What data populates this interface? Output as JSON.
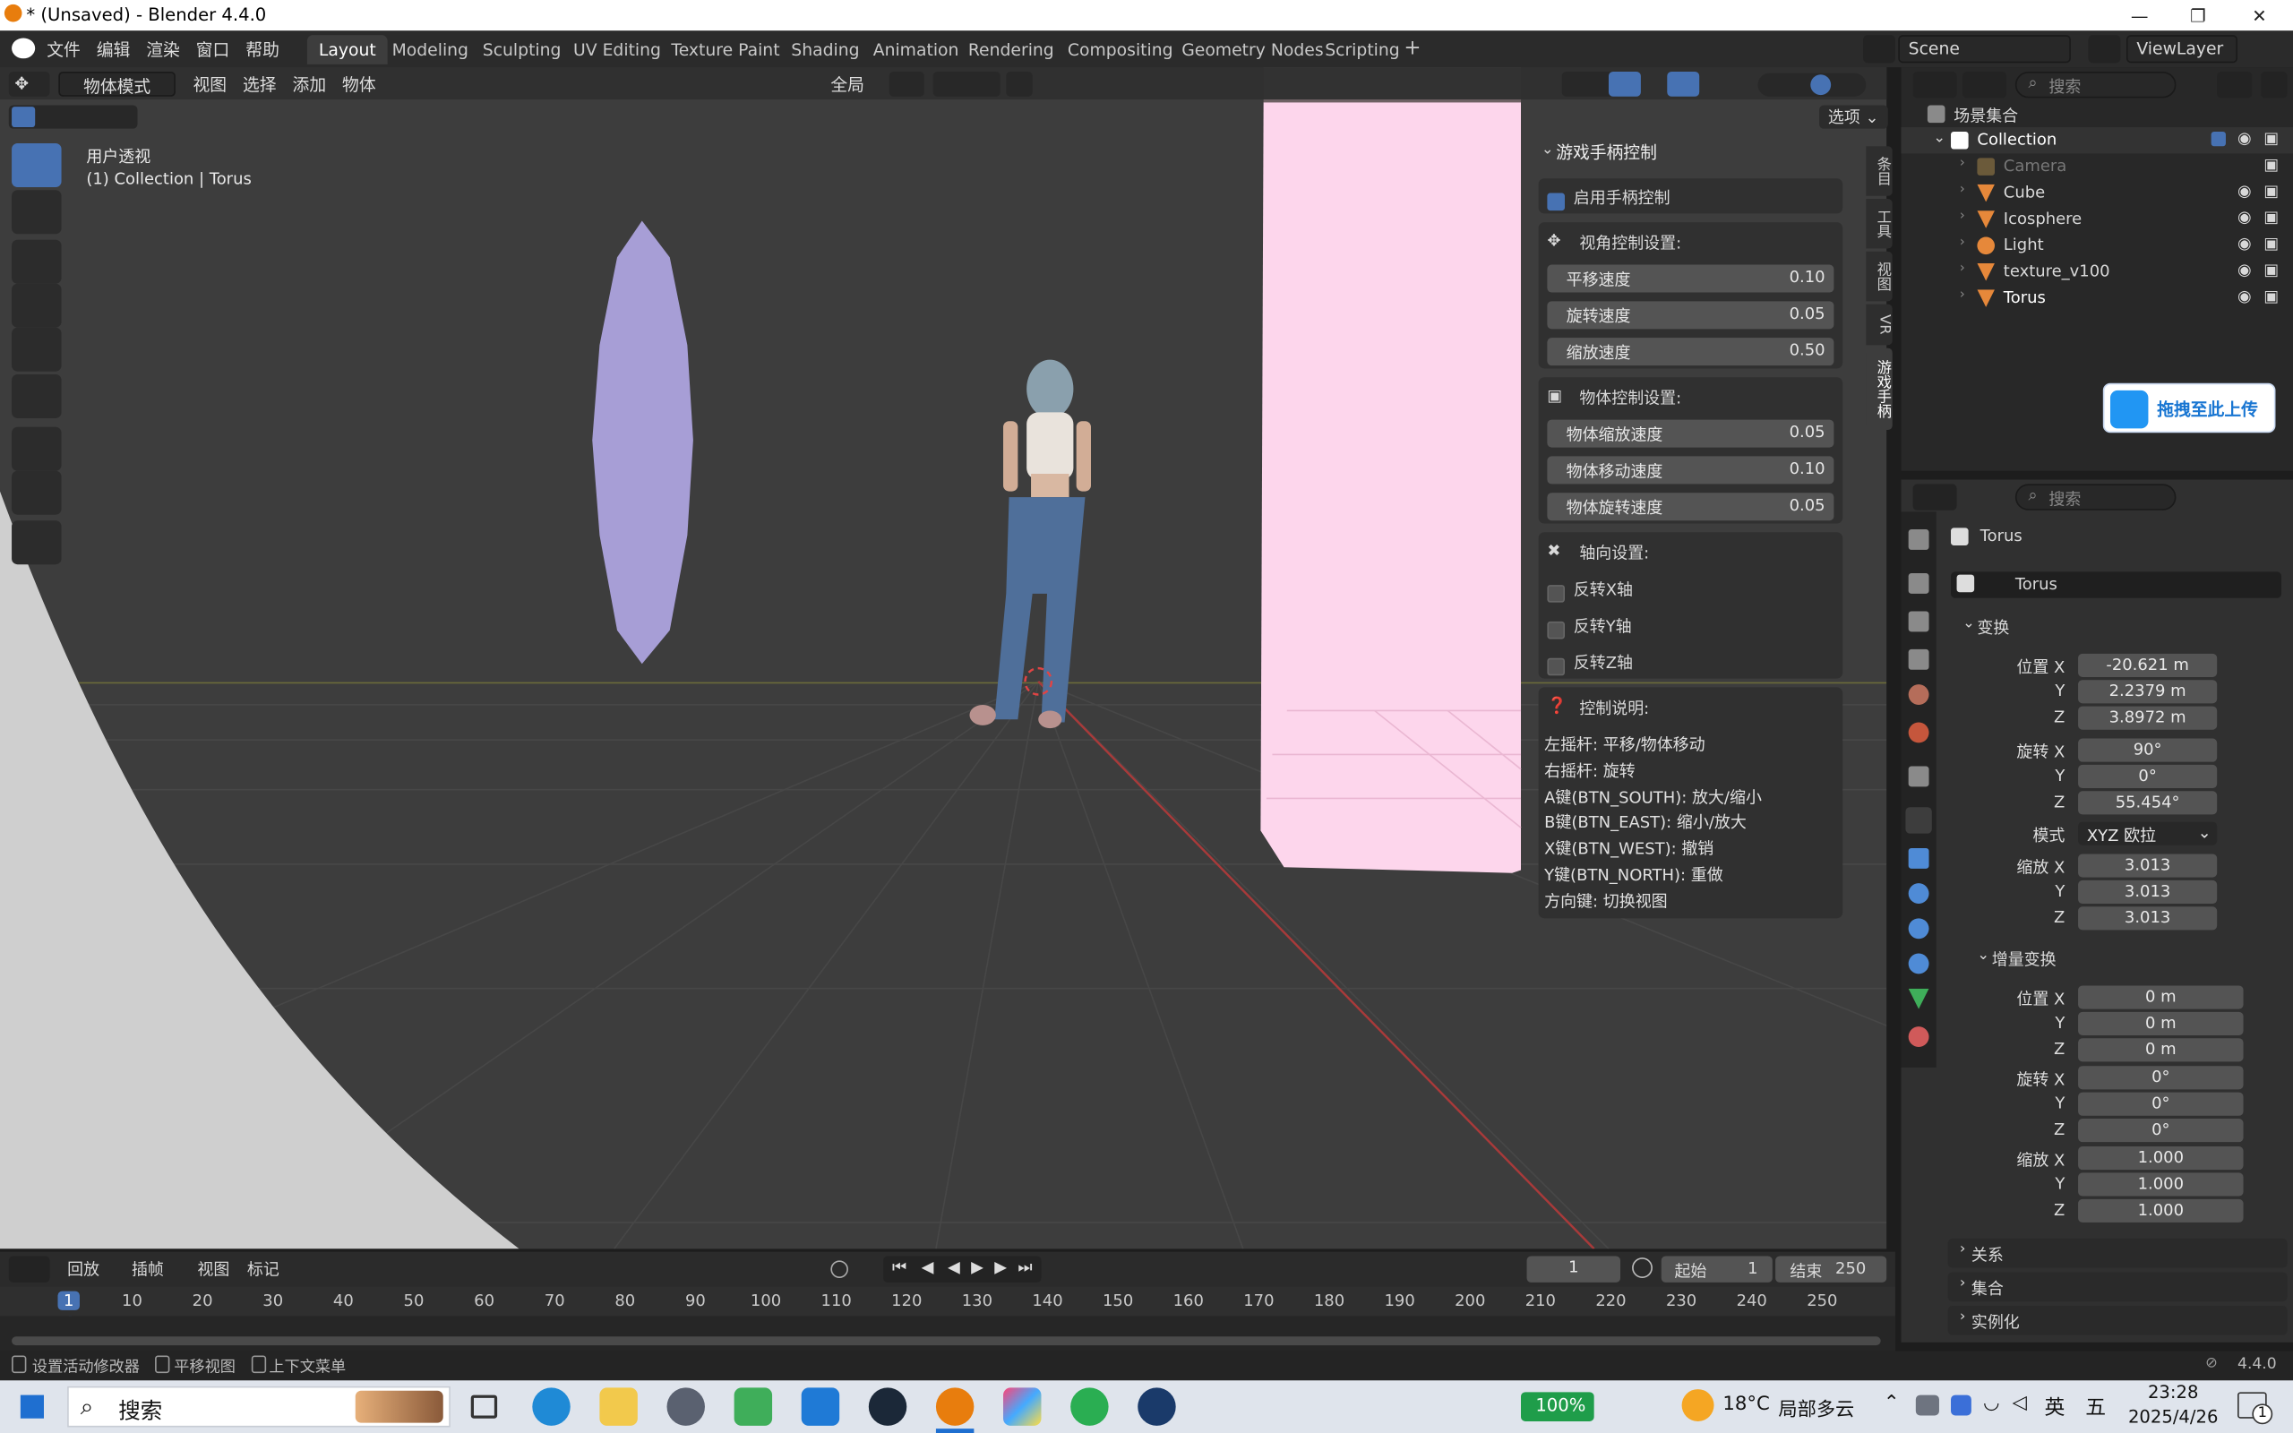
{
  "window": {
    "title": "* (Unsaved) - Blender 4.4.0"
  },
  "menu": [
    "文件",
    "编辑",
    "渲染",
    "窗口",
    "帮助"
  ],
  "workspaces": [
    {
      "label": "Layout",
      "active": true
    },
    {
      "label": "Modeling"
    },
    {
      "label": "Sculpting"
    },
    {
      "label": "UV Editing"
    },
    {
      "label": "Texture Paint"
    },
    {
      "label": "Shading"
    },
    {
      "label": "Animation"
    },
    {
      "label": "Rendering"
    },
    {
      "label": "Compositing"
    },
    {
      "label": "Geometry Nodes"
    },
    {
      "label": "Scripting"
    }
  ],
  "scene": {
    "name": "Scene",
    "view_layer": "ViewLayer"
  },
  "viewport_header": {
    "mode": "物体模式",
    "view": "视图",
    "select": "选择",
    "add": "添加",
    "object": "物体",
    "transform_orientation": "全局",
    "options": "选项"
  },
  "viewport_overlay": {
    "view_name": "用户透视",
    "context": "(1) Collection | Torus"
  },
  "npanel": {
    "title": "游戏手柄控制",
    "enable_label": "启用手柄控制",
    "enable_checked": true,
    "view_section": "视角控制设置:",
    "view_rows": [
      {
        "label": "平移速度",
        "value": "0.10"
      },
      {
        "label": "旋转速度",
        "value": "0.05"
      },
      {
        "label": "缩放速度",
        "value": "0.50"
      }
    ],
    "object_section": "物体控制设置:",
    "object_rows": [
      {
        "label": "物体缩放速度",
        "value": "0.05"
      },
      {
        "label": "物体移动速度",
        "value": "0.10"
      },
      {
        "label": "物体旋转速度",
        "value": "0.05"
      }
    ],
    "axis_section": "轴向设置:",
    "axis_rows": [
      "反转X轴",
      "反转Y轴",
      "反转Z轴"
    ],
    "help_section": "控制说明:",
    "help_lines": [
      "左摇杆: 平移/物体移动",
      "右摇杆: 旋转",
      "A键(BTN_SOUTH): 放大/缩小",
      "B键(BTN_EAST): 缩小/放大",
      "X键(BTN_WEST): 撤销",
      "Y键(BTN_NORTH): 重做",
      "方向键: 切换视图"
    ]
  },
  "side_tabs": [
    "条目",
    "工具",
    "视图",
    "VR",
    "游戏手柄"
  ],
  "outliner": {
    "search_placeholder": "搜索",
    "root": "场景集合",
    "collection": "Collection",
    "items": [
      {
        "name": "Camera",
        "icon": "camera-icon",
        "dim": true
      },
      {
        "name": "Cube",
        "icon": "mesh-icon"
      },
      {
        "name": "Icosphere",
        "icon": "mesh-icon"
      },
      {
        "name": "Light",
        "icon": "light-icon"
      },
      {
        "name": "texture_v100",
        "icon": "mesh-icon"
      },
      {
        "name": "Torus",
        "icon": "mesh-icon"
      }
    ]
  },
  "upload_badge": "拖拽至此上传",
  "properties": {
    "search_placeholder": "搜索",
    "object_name": "Torus",
    "data_name": "Torus",
    "transform_section": "变换",
    "location_label": "位置 X",
    "location": [
      "-20.621 m",
      "2.2379 m",
      "3.8972 m"
    ],
    "rotation_label": "旋转 X",
    "rotation": [
      "90°",
      "0°",
      "55.454°"
    ],
    "mode_label": "模式",
    "mode_value": "XYZ 欧拉",
    "scale_label": "缩放 X",
    "scale": [
      "3.013",
      "3.013",
      "3.013"
    ],
    "delta_section": "增量变换",
    "delta_location": [
      "0 m",
      "0 m",
      "0 m"
    ],
    "delta_rotation": [
      "0°",
      "0°",
      "0°"
    ],
    "delta_scale": [
      "1.000",
      "1.000",
      "1.000"
    ],
    "axis_y": "Y",
    "axis_z": "Z",
    "relations": "关系",
    "collections": "集合",
    "instancing": "实例化"
  },
  "timeline": {
    "playback": "回放",
    "keying": "插帧",
    "view": "视图",
    "marker": "标记",
    "current_frame": "1",
    "start_label": "起始",
    "start": "1",
    "end_label": "结束",
    "end": "250",
    "ticks": [
      "1",
      "10",
      "20",
      "30",
      "40",
      "50",
      "60",
      "70",
      "80",
      "90",
      "100",
      "110",
      "120",
      "130",
      "140",
      "150",
      "160",
      "170",
      "180",
      "190",
      "200",
      "210",
      "220",
      "230",
      "240",
      "250"
    ]
  },
  "status": {
    "hint1": "设置活动修改器",
    "hint2": "平移视图",
    "hint3": "上下文菜单",
    "version": "4.4.0"
  },
  "taskbar": {
    "search": "搜索",
    "battery": "100%",
    "weather_temp": "18°C",
    "weather_desc": "局部多云",
    "ime1": "英",
    "ime2": "五",
    "time": "23:28",
    "date": "2025/4/26",
    "notif": "1"
  }
}
